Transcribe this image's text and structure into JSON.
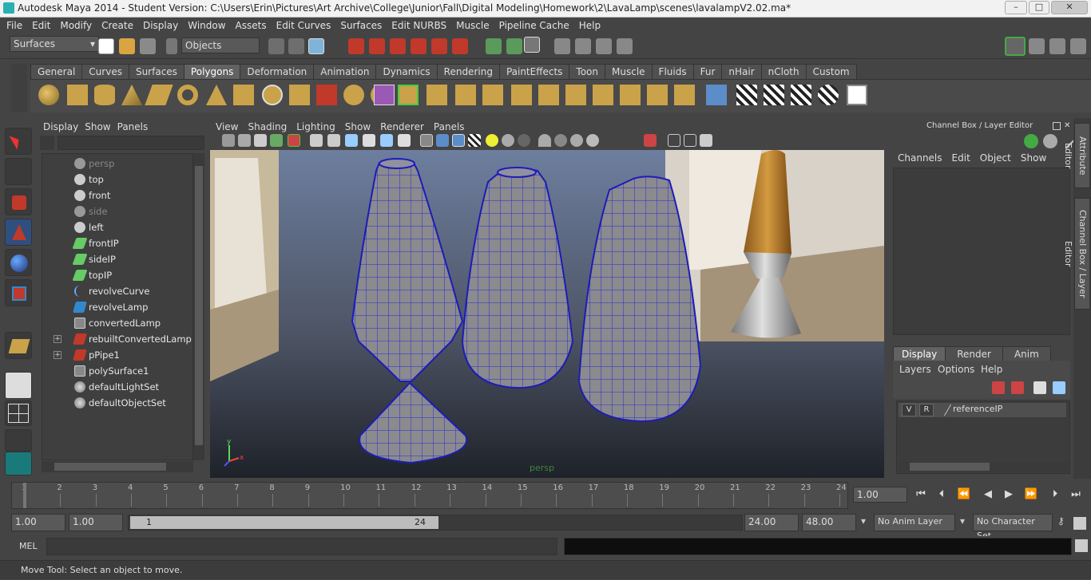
{
  "window": {
    "title": "Autodesk Maya 2014 - Student Version: C:\\Users\\Erin\\Pictures\\Art Archive\\College\\Junior\\Fall\\Digital Modeling\\Homework\\2\\LavaLamp\\scenes\\lavalampV2.02.ma*",
    "minimize": "–",
    "maximize": "□",
    "close": "✕"
  },
  "menubar": [
    "File",
    "Edit",
    "Modify",
    "Create",
    "Display",
    "Window",
    "Assets",
    "Edit Curves",
    "Surfaces",
    "Edit NURBS",
    "Muscle",
    "Pipeline Cache",
    "Help"
  ],
  "status": {
    "mode": "Surfaces",
    "objects_field": "Objects"
  },
  "shelf": {
    "tabs": [
      "General",
      "Curves",
      "Surfaces",
      "Polygons",
      "Deformation",
      "Animation",
      "Dynamics",
      "Rendering",
      "PaintEffects",
      "Toon",
      "Muscle",
      "Fluids",
      "Fur",
      "nHair",
      "nCloth",
      "Custom"
    ],
    "active_tab": "Polygons"
  },
  "outliner": {
    "menu": [
      "Display",
      "Show",
      "Panels"
    ],
    "items": [
      {
        "label": "persp",
        "icon": "camera-icon",
        "dim": true,
        "expand": false
      },
      {
        "label": "top",
        "icon": "camera-icon",
        "dim": false,
        "expand": false
      },
      {
        "label": "front",
        "icon": "camera-icon",
        "dim": false,
        "expand": false
      },
      {
        "label": "side",
        "icon": "camera-icon",
        "dim": true,
        "expand": false
      },
      {
        "label": "left",
        "icon": "camera-icon",
        "dim": false,
        "expand": false
      },
      {
        "label": "frontIP",
        "icon": "image-plane-icon",
        "dim": false,
        "expand": false
      },
      {
        "label": "sideIP",
        "icon": "image-plane-icon",
        "dim": false,
        "expand": false
      },
      {
        "label": "topIP",
        "icon": "image-plane-icon",
        "dim": false,
        "expand": false
      },
      {
        "label": "revolveCurve",
        "icon": "curve-icon",
        "dim": false,
        "expand": false
      },
      {
        "label": "revolveLamp",
        "icon": "nurbs-surface-icon",
        "dim": false,
        "expand": false
      },
      {
        "label": "convertedLamp",
        "icon": "poly-mesh-icon",
        "dim": false,
        "expand": false
      },
      {
        "label": "rebuiltConvertedLamp",
        "icon": "nurbs-surface-icon",
        "dim": false,
        "expand": true
      },
      {
        "label": "pPipe1",
        "icon": "nurbs-surface-icon",
        "dim": false,
        "expand": true
      },
      {
        "label": "polySurface1",
        "icon": "poly-mesh-icon",
        "dim": false,
        "expand": false
      },
      {
        "label": "defaultLightSet",
        "icon": "set-icon",
        "dim": false,
        "expand": false
      },
      {
        "label": "defaultObjectSet",
        "icon": "set-icon",
        "dim": false,
        "expand": false
      }
    ]
  },
  "viewport": {
    "menu": [
      "View",
      "Shading",
      "Lighting",
      "Show",
      "Renderer",
      "Panels"
    ],
    "camera_label": "persp",
    "axis_x": "x",
    "axis_y": "y"
  },
  "channelbox": {
    "title": "Channel Box / Layer Editor",
    "menu": [
      "Channels",
      "Edit",
      "Object",
      "Show"
    ],
    "layer_tabs": [
      "Display",
      "Render",
      "Anim"
    ],
    "layer_menu": [
      "Layers",
      "Options",
      "Help"
    ],
    "layer": {
      "v": "V",
      "r": "R",
      "name": "referenceIP"
    }
  },
  "sidetabs": [
    "Attribute Editor",
    "Channel Box / Layer Editor"
  ],
  "timeslider": {
    "ticks": [
      "1",
      "2",
      "3",
      "4",
      "5",
      "6",
      "7",
      "8",
      "9",
      "10",
      "11",
      "12",
      "13",
      "14",
      "15",
      "16",
      "17",
      "18",
      "19",
      "20",
      "21",
      "22",
      "23",
      "24"
    ],
    "current_frame": "1.00"
  },
  "range": {
    "start": "1.00",
    "playback_start": "1.00",
    "range_start_label": "1",
    "range_end_label": "24",
    "playback_end": "24.00",
    "end": "48.00",
    "anim_layer": "No Anim Layer",
    "character_set": "No Character Set"
  },
  "cmdline": {
    "label": "MEL"
  },
  "helpline": "Move Tool: Select an object to move."
}
